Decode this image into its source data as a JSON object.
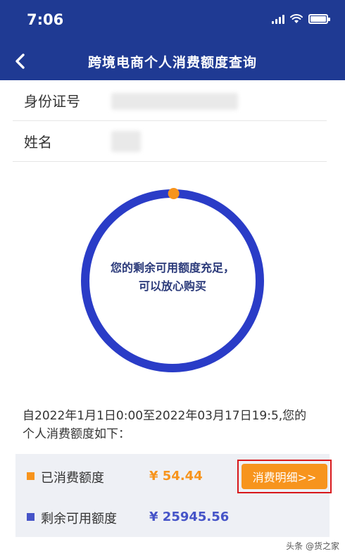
{
  "status_bar": {
    "time": "7:06",
    "icons": [
      "signal-icon",
      "wifi-icon",
      "battery-icon"
    ]
  },
  "nav": {
    "back_icon": "chevron-left-icon",
    "title": "跨境电商个人消费额度查询"
  },
  "identity": {
    "id_label": "身份证号",
    "name_label": "姓名"
  },
  "quota_ring": {
    "message": "您的剩余可用额度充足，可以放心购买",
    "used_fraction": 0.0021,
    "ring_color": "#2a3cc7",
    "marker_color": "#f7941d"
  },
  "period_text": "自2022年1月1日0:00至2022年03月17日19:5,您的个人消费额度如下：",
  "summary": {
    "used": {
      "label": "已消费额度",
      "value": "¥ 54.44",
      "color": "#f7941d"
    },
    "remaining": {
      "label": "剩余可用额度",
      "value": "¥ 25945.56",
      "color": "#4654c8"
    },
    "detail_button": "消费明细>>"
  },
  "watermark": "头条 @货之家"
}
